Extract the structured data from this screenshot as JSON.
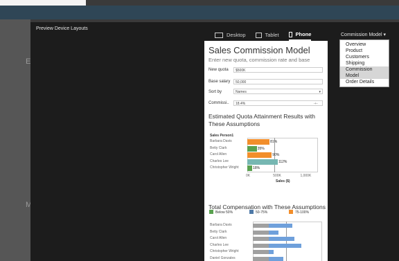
{
  "dialog": {
    "title": "Preview Device Layouts",
    "devices": [
      {
        "label": "Desktop",
        "icon": "desktop-icon"
      },
      {
        "label": "Tablet",
        "icon": "tablet-icon"
      },
      {
        "label": "Phone",
        "icon": "phone-icon"
      }
    ],
    "active_device": "Phone",
    "sheet_selector": {
      "value": "Commission Model"
    },
    "sheet_options": [
      "Overview",
      "Product",
      "Customers",
      "Shipping",
      "Commission Model",
      "Order Details"
    ],
    "background_letters": [
      "E",
      "M"
    ]
  },
  "dashboard": {
    "title": "Sales Commission Model",
    "subtitle": "Enter new quota, commission rate and base",
    "fields": [
      {
        "label": "New quota",
        "value": "$500K"
      },
      {
        "label": "Base salary",
        "value": "50,000"
      },
      {
        "label": "Sort by",
        "value": "Names"
      },
      {
        "label": "Commissi..",
        "value": "18.4%"
      }
    ],
    "section1_title": "Estimated Quota Attainment Results with These Assumptions",
    "section2_title": "Total Compensation with These Assumptions"
  },
  "colors": {
    "green": "#59a14f",
    "blue": "#4e79a7",
    "orange": "#f28e2b",
    "teal": "#76b7b2",
    "comp_gray": "#a0a0a0",
    "comp_blue": "#6fa0db"
  },
  "chart_data": [
    {
      "type": "bar",
      "title": "Estimated Quota Attainment Results with These Assumptions",
      "column_header": "Sales Person1",
      "categories": [
        "Barbara Davis",
        "Betty Clark",
        "Carol Allen",
        "Charles Lee",
        "Christopher Wright"
      ],
      "values": [
        410000,
        175000,
        450000,
        560000,
        90000
      ],
      "data_labels": [
        "81%",
        "35%",
        "90%",
        "112%",
        "18%"
      ],
      "bar_colors": [
        "#f28e2b",
        "#59a14f",
        "#f28e2b",
        "#76b7b2",
        "#59a14f"
      ],
      "xlabel": "Sales ($)",
      "xticks": [
        "0K",
        "500K",
        "1,000K"
      ],
      "xlim": [
        0,
        1300000
      ],
      "legend": [
        {
          "label": "Below 50%",
          "color": "#59a14f"
        },
        {
          "label": "50-75%",
          "color": "#4e79a7"
        },
        {
          "label": "75-100%",
          "color": "#f28e2b"
        }
      ]
    },
    {
      "type": "bar",
      "title": "Total Compensation with These Assumptions",
      "categories": [
        "Barbara Davis",
        "Betty Clark",
        "Carol Allen",
        "Charles Lee",
        "Christopher Wright",
        "Daniel Gonzales"
      ],
      "series": [
        {
          "values": [
            50000,
            50000,
            50000,
            50000,
            50000,
            50000
          ],
          "color": "#a0a0a0"
        },
        {
          "values": [
            75000,
            32000,
            83000,
            103000,
            17000,
            46000
          ],
          "color": "#6fa0db"
        }
      ]
    }
  ]
}
